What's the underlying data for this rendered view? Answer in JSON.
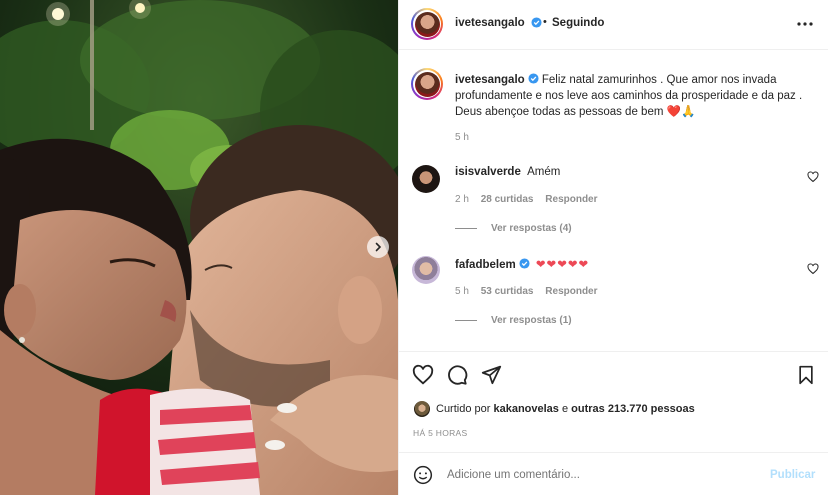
{
  "post": {
    "author": "ivetesangalo",
    "follow_status": "Seguindo",
    "separator": "•",
    "caption_text": "Feliz natal zamurinhos . Que amor nos invada profundamente e nos leve aos caminhos da prosperidade e da paz . Deus abençoe todas as pessoas de bem",
    "caption_emojis": "❤️🙏",
    "caption_time": "5 h"
  },
  "comments": [
    {
      "user": "isisvalverde",
      "text": "Amém",
      "time": "2 h",
      "likes": "28 curtidas",
      "reply": "Responder",
      "view_replies": "Ver respostas (4)"
    },
    {
      "user": "fafadbelem",
      "text": "❤❤❤❤❤",
      "time": "5 h",
      "likes": "53 curtidas",
      "reply": "Responder",
      "view_replies": "Ver respostas (1)"
    }
  ],
  "likes": {
    "prefix": "Curtido por",
    "user": "kakanovelas",
    "connector": "e",
    "others": "outras 213.770 pessoas"
  },
  "timestamp": "HÁ 5 HORAS",
  "comment_box": {
    "placeholder": "Adicione um comentário...",
    "publish": "Publicar"
  },
  "icons": {
    "more": "more-options-icon",
    "like": "heart-icon",
    "comment": "comment-icon",
    "share": "share-icon",
    "save": "bookmark-icon",
    "emoji": "emoji-icon",
    "next": "chevron-right-icon",
    "verified": "verified-badge-icon"
  },
  "colors": {
    "verified": "#3897f0",
    "publish_disabled": "#b2dffc",
    "heart_red": "#ed4956"
  }
}
